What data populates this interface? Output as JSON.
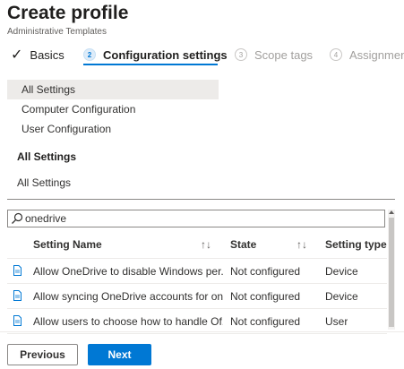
{
  "header": {
    "title": "Create profile",
    "subtitle": "Administrative Templates"
  },
  "wizard": {
    "steps": [
      {
        "number": "",
        "label": "Basics",
        "state": "completed"
      },
      {
        "number": "2",
        "label": "Configuration settings",
        "state": "active"
      },
      {
        "number": "3",
        "label": "Scope tags",
        "state": "inactive"
      },
      {
        "number": "4",
        "label": "Assignments",
        "state": "inactive"
      }
    ]
  },
  "settings_nav": {
    "items": [
      "All Settings",
      "Computer Configuration",
      "User Configuration"
    ],
    "selected": "All Settings"
  },
  "section": {
    "heading": "All Settings",
    "breadcrumb": "All Settings"
  },
  "search": {
    "value": "onedrive",
    "icon": "search-icon"
  },
  "table": {
    "columns": [
      "Setting Name",
      "State",
      "Setting type"
    ],
    "rows": [
      {
        "name": "Allow OneDrive to disable Windows per...",
        "state": "Not configured",
        "type": "Device"
      },
      {
        "name": "Allow syncing OneDrive accounts for on...",
        "state": "Not configured",
        "type": "Device"
      },
      {
        "name": "Allow users to choose how to handle Of...",
        "state": "Not configured",
        "type": "User"
      }
    ]
  },
  "footer": {
    "previous_label": "Previous",
    "next_label": "Next"
  },
  "colors": {
    "accent": "#0078d4",
    "selected_bg": "#edebe9",
    "muted_text": "#a19f9d"
  }
}
